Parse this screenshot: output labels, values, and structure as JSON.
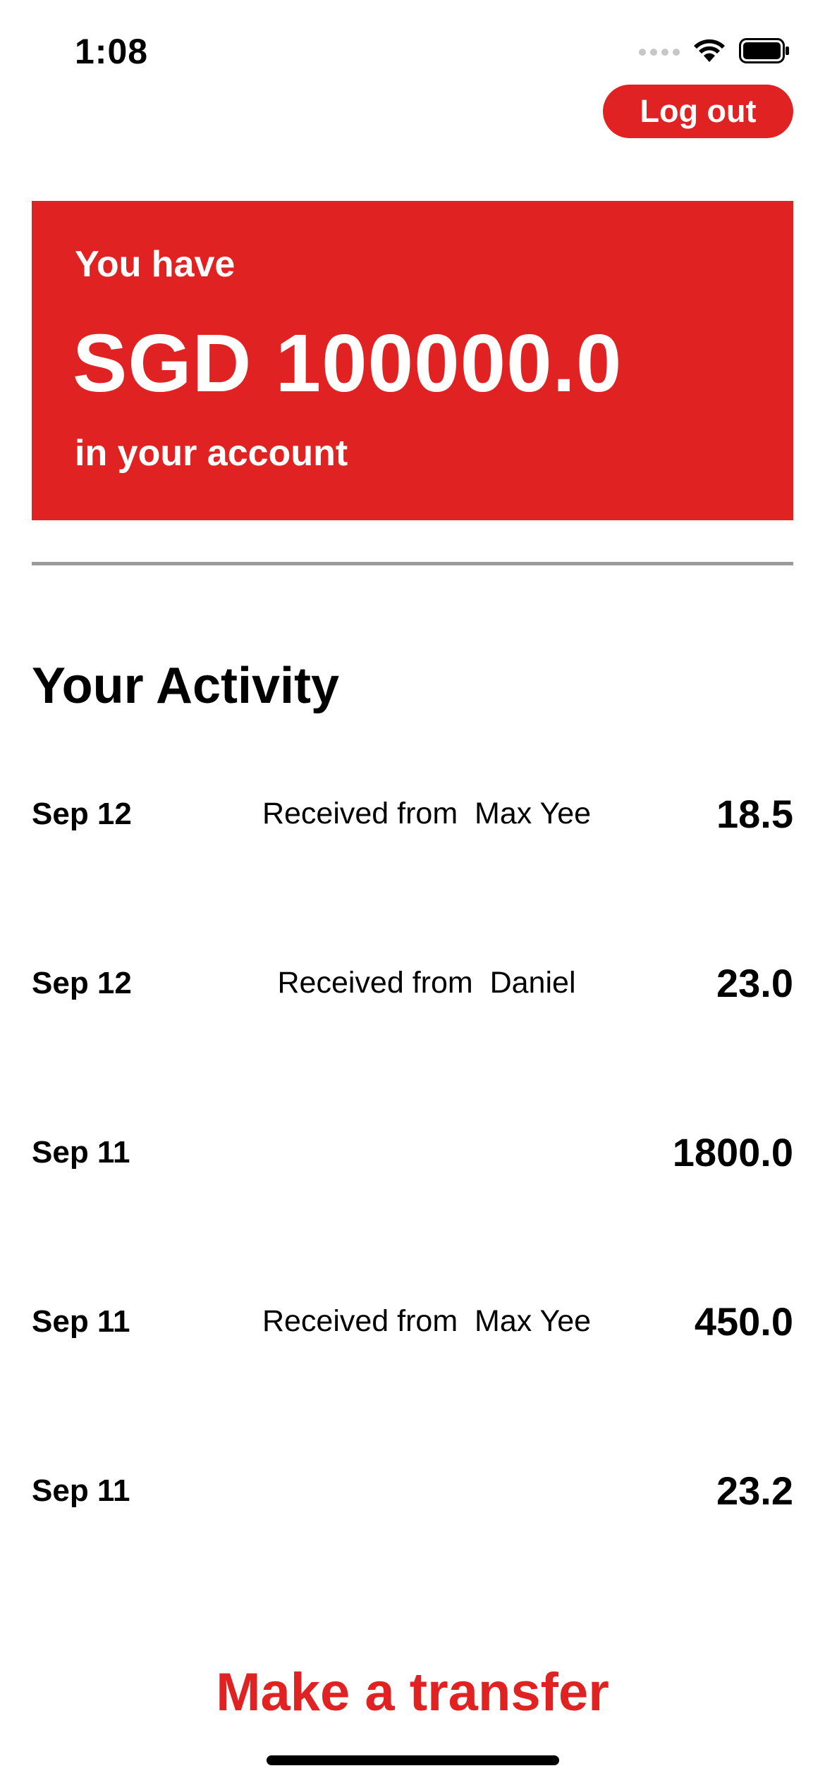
{
  "status_bar": {
    "time": "1:08",
    "icons": [
      "cellular-signal-icon",
      "wifi-icon",
      "battery-icon"
    ]
  },
  "header": {
    "logout_label": "Log out"
  },
  "balance": {
    "prefix": "You have",
    "amount": "SGD 100000.0",
    "suffix": "in your account"
  },
  "activity": {
    "title": "Your Activity",
    "items": [
      {
        "date": "Sep 12",
        "description": "Received from  Max Yee",
        "amount": "18.5"
      },
      {
        "date": "Sep 12",
        "description": "Received from  Daniel",
        "amount": "23.0"
      },
      {
        "date": "Sep 11",
        "description": "",
        "amount": "1800.0"
      },
      {
        "date": "Sep 11",
        "description": "Received from  Max Yee",
        "amount": "450.0"
      },
      {
        "date": "Sep 11",
        "description": "",
        "amount": "23.2"
      }
    ]
  },
  "footer": {
    "transfer_label": "Make a transfer"
  },
  "colors": {
    "accent": "#e02322",
    "divider": "#9a9a9a",
    "background": "#ffffff",
    "text": "#000000"
  }
}
